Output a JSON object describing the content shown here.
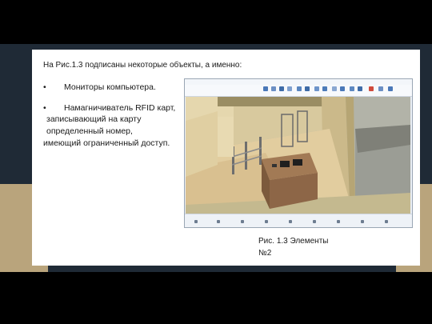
{
  "slide": {
    "title": "На Рис.1.3 подписаны некоторые объекты, а именно:",
    "bullets": [
      {
        "marker": "•",
        "text": "Мониторы компьютера."
      },
      {
        "marker": "•",
        "text": "Намагничиватель RFID карт,"
      }
    ],
    "continuation": [
      "записывающий на карту",
      "определенный номер,",
      "имеющий ограниченный доступ."
    ],
    "caption_line1": "Рис. 1.3 Элементы",
    "caption_line2": "№2"
  },
  "colors": {
    "background": "#1f2a36",
    "accent_gold": "#b9a47c",
    "card": "#ffffff",
    "wall": "#c9b889",
    "floor": "#dcc79b",
    "desk": "#8a6343"
  },
  "icons": [
    "toolbar-icon",
    "status-icon"
  ]
}
